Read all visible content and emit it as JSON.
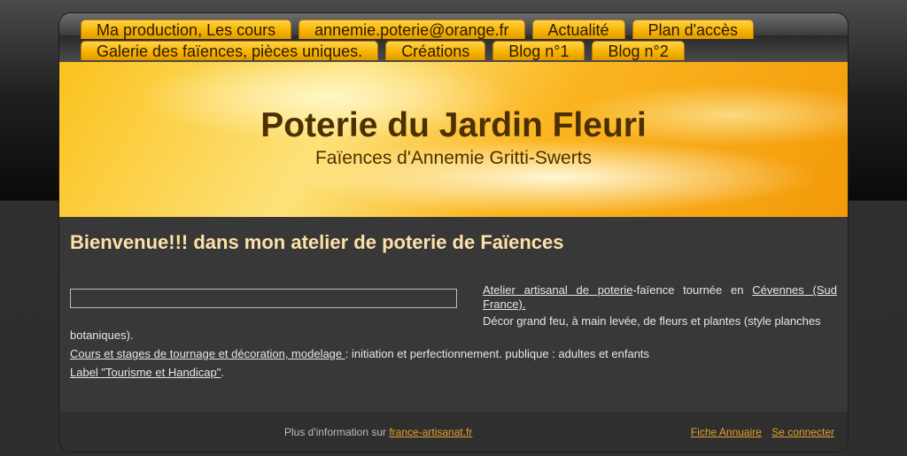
{
  "nav": {
    "row1": [
      "Ma production, Les cours",
      "annemie.poterie@orange.fr",
      "Actualité",
      "Plan d'accès"
    ],
    "row2": [
      "Galerie des faïences, pièces uniques.",
      "Créations",
      "Blog n°1",
      "Blog n°2"
    ]
  },
  "banner": {
    "title": "Poterie du Jardin Fleuri",
    "subtitle": "Faïences d'Annemie Gritti-Swerts"
  },
  "content": {
    "welcome": "Bienvenue!!! dans mon atelier de poterie de Faïences",
    "p1_link1": "Atelier artisanal de poterie",
    "p1_text": "-faïence tournée en ",
    "p1_link2": "Cévennes (Sud France).",
    "p2_text_a": "Décor grand feu, à main levée, de fleurs et plantes (style planches",
    "p2_text_b": "botaniques).",
    "p3_link": "Cours et stages de tournage et décoration, modelage ",
    "p3_text": ": initiation et perfectionnement. publique : adultes et enfants",
    "p4_link": "Label \"Tourisme et Handicap\"",
    "p4_text": "."
  },
  "footer": {
    "info_text": "Plus d'information sur ",
    "info_link": "france-artisanat.fr",
    "fiche": "Fiche Annuaire",
    "connect": "Se connecter"
  },
  "colors": {
    "accent": "#f7b400",
    "heading": "#fde1a8",
    "link_footer": "#e3a12a"
  }
}
